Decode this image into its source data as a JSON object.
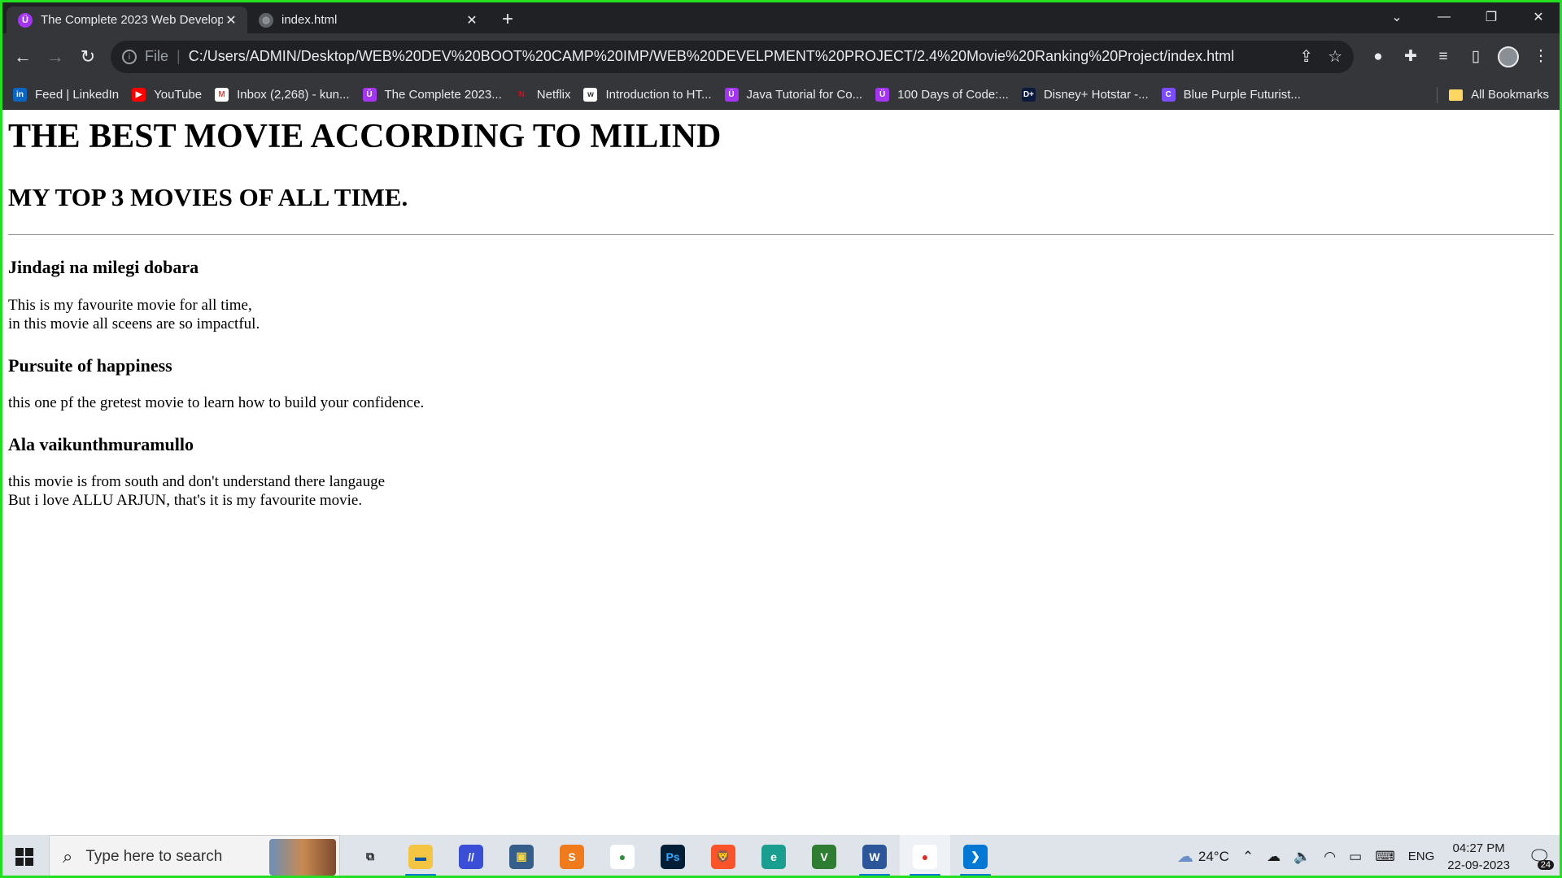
{
  "browser": {
    "tabs": [
      {
        "title": "The Complete 2023 Web Develop",
        "favicon": "udemy-icon",
        "active": true
      },
      {
        "title": "index.html",
        "favicon": "globe-icon",
        "active": false
      }
    ],
    "new_tab_label": "+",
    "address_bar": {
      "scheme": "File",
      "url": "C:/Users/ADMIN/Desktop/WEB%20DEV%20BOOT%20CAMP%20IMP/WEB%20DEVELPMENT%20PROJECT/2.4%20Movie%20Ranking%20Project/index.html"
    },
    "bookmarks": [
      {
        "label": "Feed | LinkedIn",
        "icon": "linkedin-icon",
        "glyph": "in"
      },
      {
        "label": "YouTube",
        "icon": "youtube-icon",
        "glyph": "▶"
      },
      {
        "label": "Inbox (2,268) - kun...",
        "icon": "gmail-icon",
        "glyph": "M"
      },
      {
        "label": "The Complete 2023...",
        "icon": "udemy-icon",
        "glyph": "Ü"
      },
      {
        "label": "Netflix",
        "icon": "netflix-icon",
        "glyph": "N"
      },
      {
        "label": "Introduction to HT...",
        "icon": "w3schools-icon",
        "glyph": "w"
      },
      {
        "label": "Java Tutorial for Co...",
        "icon": "udemy-icon",
        "glyph": "Ü"
      },
      {
        "label": "100 Days of Code:...",
        "icon": "udemy-icon",
        "glyph": "Ü"
      },
      {
        "label": "Disney+ Hotstar -...",
        "icon": "hotstar-icon",
        "glyph": "D+"
      },
      {
        "label": "Blue Purple Futurist...",
        "icon": "canva-icon",
        "glyph": "C"
      }
    ],
    "all_bookmarks_label": "All Bookmarks"
  },
  "page": {
    "h1": "THE BEST MOVIE ACCORDING TO MILIND",
    "h2": "MY TOP 3 MOVIES OF ALL TIME.",
    "movies": [
      {
        "title": "Jindagi na milegi dobara",
        "lines": [
          "This is my favourite movie for all time,",
          "in this movie all sceens are so impactful."
        ]
      },
      {
        "title": "Pursuite of happiness",
        "lines": [
          "this one pf the gretest movie to learn how to build your confidence."
        ]
      },
      {
        "title": "Ala vaikunthmuramullo",
        "lines": [
          "this movie is from south and don't understand there langauge",
          "But i love ALLU ARJUN, that's it is my favourite movie."
        ]
      }
    ]
  },
  "taskbar": {
    "search_placeholder": "Type here to search",
    "apps": [
      {
        "name": "task-view",
        "glyph": "⧉",
        "color": "transparent",
        "fg": "#1b1b1b"
      },
      {
        "name": "file-explorer",
        "glyph": "▬",
        "color": "#f4c542",
        "fg": "#0a58a8",
        "running": true
      },
      {
        "name": "azure-data-studio",
        "glyph": "//",
        "color": "#3a4ed8",
        "fg": "#ffffff"
      },
      {
        "name": "python",
        "glyph": "▣",
        "color": "#355f8a",
        "fg": "#f7d648"
      },
      {
        "name": "sublime-text",
        "glyph": "S",
        "color": "#f07b1d",
        "fg": "#ffffff"
      },
      {
        "name": "chrome",
        "glyph": "●",
        "color": "#ffffff",
        "fg": "#2f8f3f"
      },
      {
        "name": "photoshop",
        "glyph": "Ps",
        "color": "#001e36",
        "fg": "#31a8ff"
      },
      {
        "name": "brave",
        "glyph": "🦁",
        "color": "#fb542b",
        "fg": "#ffffff"
      },
      {
        "name": "edge-beta",
        "glyph": "e",
        "color": "#1a9e8f",
        "fg": "#ffffff"
      },
      {
        "name": "vim",
        "glyph": "V",
        "color": "#2e7d32",
        "fg": "#ffffff"
      },
      {
        "name": "word",
        "glyph": "W",
        "color": "#2b579a",
        "fg": "#ffffff",
        "running": true
      },
      {
        "name": "chrome-profile",
        "glyph": "●",
        "color": "#ffffff",
        "fg": "#d93025",
        "running": true,
        "active": true
      },
      {
        "name": "vscode",
        "glyph": "❯",
        "color": "#0078d4",
        "fg": "#ffffff",
        "running": true
      }
    ],
    "weather": "24°C",
    "language": "ENG",
    "time": "04:27 PM",
    "date": "22-09-2023",
    "notification_count": "24"
  },
  "colors": {
    "frame": "#22e01f",
    "chrome_dark": "#202124",
    "chrome_toolbar": "#35363a",
    "taskbar": "#dfe3ea"
  }
}
